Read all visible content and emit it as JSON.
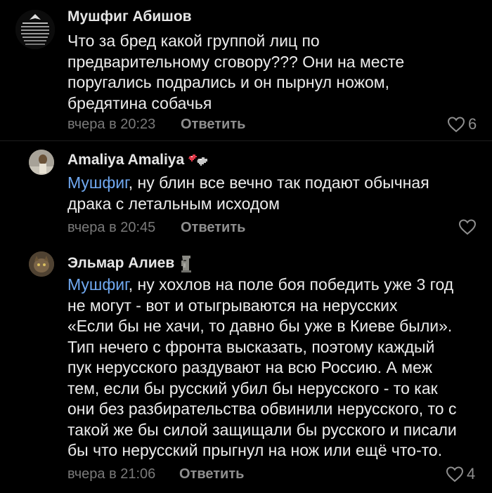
{
  "comments": [
    {
      "author": "Мушфиг Абишов",
      "lines": [
        "Что за бред какой группой лиц по",
        "предварительному сговору??? Они на месте",
        "поругались подрались и он пырнул ножом,",
        "бредятина собачья"
      ],
      "time": "вчера в 20:23",
      "reply_label": "Ответить",
      "likes": "6"
    },
    {
      "author": "Amaliya Amaliya",
      "mention": "Мушфиг",
      "lines": [
        ", ну блин все вечно так подают обычная",
        "драка с летальным исходом"
      ],
      "time": "вчера в 20:45",
      "reply_label": "Ответить",
      "likes": ""
    },
    {
      "author": "Эльмар Алиев",
      "mention": "Мушфиг",
      "lines": [
        ", ну хохлов на поле боя победить уже 3 год",
        "не могут - вот и отыгрываются на нерусских",
        "«Если бы не хачи, то давно бы уже в Киеве были».",
        "Тип нечего с фронта высказать, поэтому каждый",
        "пук нерусского раздувают на всю Россию. А меж",
        "тем, если бы русский убил бы нерусского - то как",
        "они без разбирательства обвинили нерусского, то с",
        "такой же бы силой защищали бы русского и писали",
        "бы что нерусский прыгнул на нож или ещё что-то."
      ],
      "time": "вчера в 21:06",
      "reply_label": "Ответить",
      "likes": "4"
    }
  ],
  "colors": {
    "mention": "#70a8f0",
    "background": "#000000"
  },
  "icons": {
    "like": "heart-outline-icon",
    "badge_hearts": "pixel-heart-emoji",
    "badge_moai": "moai-emoji"
  }
}
